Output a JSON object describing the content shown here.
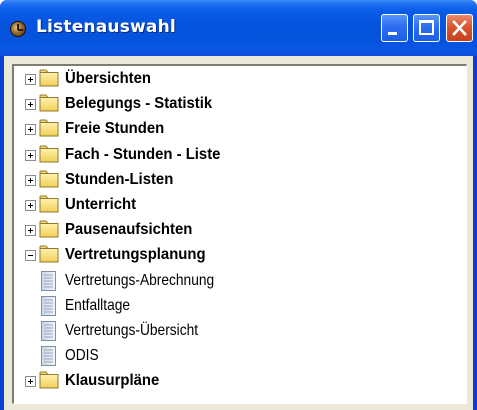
{
  "window": {
    "title": "Listenauswahl",
    "title_icon": "clock-icon",
    "controls": [
      "minimize-icon",
      "maximize-icon",
      "close-icon"
    ]
  },
  "colors": {
    "titlebar": "#0654e0",
    "close_button": "#d8552f",
    "folder": "#f5d773",
    "client_bg": "#ece9d8"
  },
  "tree": {
    "items": [
      {
        "label": "Übersichten",
        "type": "folder",
        "expanded": false
      },
      {
        "label": "Belegungs - Statistik",
        "type": "folder",
        "expanded": false
      },
      {
        "label": "Freie Stunden",
        "type": "folder",
        "expanded": false
      },
      {
        "label": "Fach - Stunden - Liste",
        "type": "folder",
        "expanded": false
      },
      {
        "label": "Stunden-Listen",
        "type": "folder",
        "expanded": false
      },
      {
        "label": "Unterricht",
        "type": "folder",
        "expanded": false
      },
      {
        "label": "Pausenaufsichten",
        "type": "folder",
        "expanded": false
      },
      {
        "label": "Vertretungsplanung",
        "type": "folder",
        "expanded": true
      },
      {
        "label": "Vertretungs-Abrechnung",
        "type": "document"
      },
      {
        "label": "Entfalltage",
        "type": "document"
      },
      {
        "label": "Vertretungs-Übersicht",
        "type": "document"
      },
      {
        "label": "ODIS",
        "type": "document"
      },
      {
        "label": "Klausurpläne",
        "type": "folder",
        "expanded": false
      }
    ]
  }
}
